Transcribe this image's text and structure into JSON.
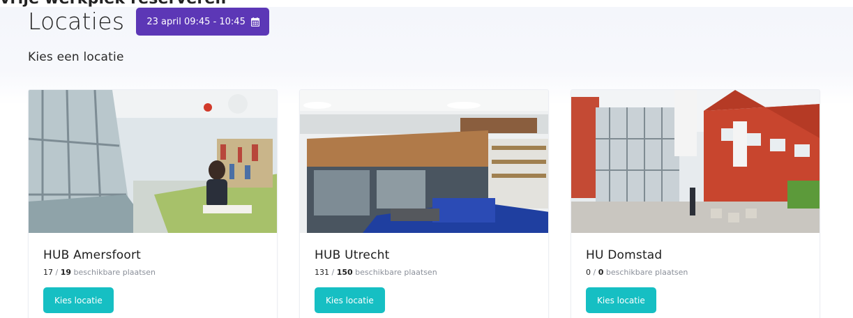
{
  "top_cutoff_text": "vrije werkplek reserveren",
  "header": {
    "title": "Locaties",
    "datetime_label": "23 april 09:45 - 10:45",
    "datetime_icon": "calendar-icon"
  },
  "subtitle": "Kies een locatie",
  "colors": {
    "accent_purple": "#5c37b6",
    "button_teal": "#16bfc3"
  },
  "locations": [
    {
      "name": "HUB Amersfoort",
      "available": "17",
      "total": "19",
      "available_text": "beschikbare plaatsen",
      "button_label": "Kies locatie"
    },
    {
      "name": "HUB Utrecht",
      "available": "131",
      "total": "150",
      "available_text": "beschikbare plaatsen",
      "button_label": "Kies locatie"
    },
    {
      "name": "HU Domstad",
      "available": "0",
      "total": "0",
      "available_text": "beschikbare plaatsen",
      "button_label": "Kies locatie"
    }
  ]
}
